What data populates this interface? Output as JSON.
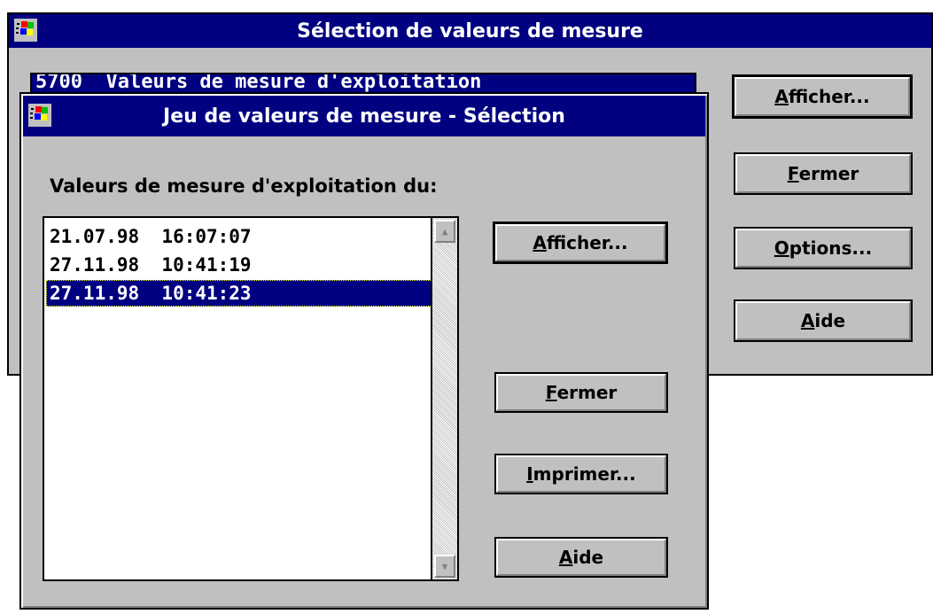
{
  "main_dialog": {
    "title": "Sélection de valeurs de mesure",
    "combo_value": "5700  Valeurs de mesure d'exploitation",
    "buttons": {
      "afficher": "Afficher...",
      "fermer": "Fermer",
      "options": "Options...",
      "aide": "Aide"
    }
  },
  "sub_dialog": {
    "title": "Jeu de valeurs de mesure - Sélection",
    "label": "Valeurs de mesure d'exploitation du:",
    "list_items": [
      "21.07.98  16:07:07",
      "27.11.98  10:41:19",
      "27.11.98  10:41:23"
    ],
    "selected_index": 2,
    "buttons": {
      "afficher": "Afficher...",
      "fermer": "Fermer",
      "imprimer": "Imprimer...",
      "aide": "Aide"
    }
  },
  "icon_names": [
    "windows-flag-icon",
    "scroll-up-arrow-icon",
    "scroll-down-arrow-icon"
  ],
  "colors": {
    "titlebar": "#000080",
    "face": "#c0c0c0",
    "selection": "#000080"
  }
}
